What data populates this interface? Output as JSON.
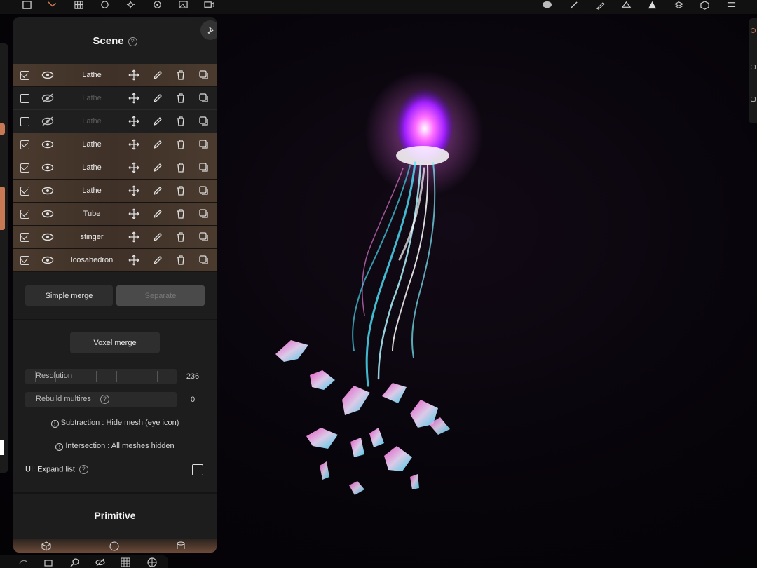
{
  "scene": {
    "title": "Scene",
    "help": "?",
    "items": [
      {
        "name": "Lathe",
        "checked": true,
        "visible": true
      },
      {
        "name": "Lathe",
        "checked": false,
        "visible": false
      },
      {
        "name": "Lathe",
        "checked": false,
        "visible": false
      },
      {
        "name": "Lathe",
        "checked": true,
        "visible": true
      },
      {
        "name": "Lathe",
        "checked": true,
        "visible": true
      },
      {
        "name": "Lathe",
        "checked": true,
        "visible": true
      },
      {
        "name": "Tube",
        "checked": true,
        "visible": true
      },
      {
        "name": "stinger",
        "checked": true,
        "visible": true
      },
      {
        "name": "Icosahedron",
        "checked": true,
        "visible": true
      }
    ],
    "simple_merge": "Simple merge",
    "separate": "Separate",
    "voxel_merge": "Voxel merge",
    "resolution_label": "Resolution",
    "resolution_value": "236",
    "rebuild_label": "Rebuild multires",
    "rebuild_value": "0",
    "subtraction_info": "Subtraction : Hide mesh (eye icon)",
    "intersection_info": "Intersection : All meshes hidden",
    "expand_label": "UI: Expand list",
    "expand_checked": false
  },
  "primitive": {
    "title": "Primitive"
  },
  "colors": {
    "active_row": "#4a3a2e",
    "accent": "#c87852",
    "panel": "#1d1d1d"
  }
}
